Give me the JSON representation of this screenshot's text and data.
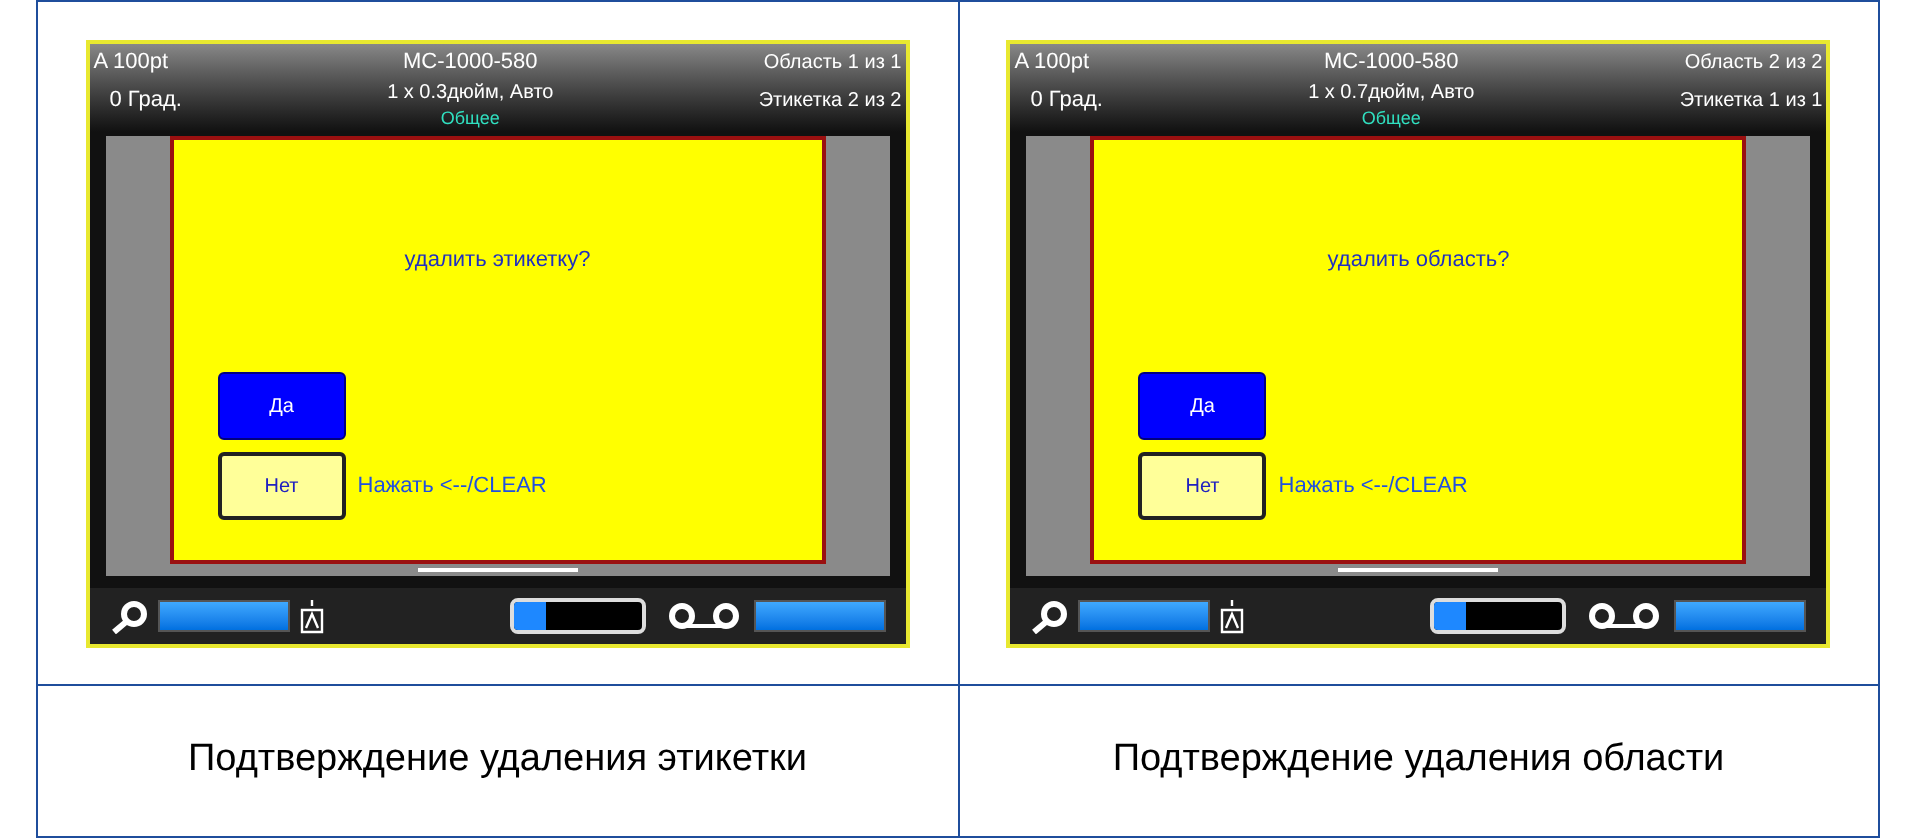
{
  "panels": [
    {
      "screen": {
        "font_size": "A 100pt",
        "rotation": "0 Град.",
        "part_number": "MC-1000-580",
        "label_size": "1 x 0.3дюйм, Авто",
        "mode": "Общее",
        "area_counter": "Область 1 из 1",
        "label_counter": "Этикетка 2 из 2",
        "dialog": {
          "question": "удалить этикетку?",
          "buttons": [
            {
              "label": "Да",
              "selected": true
            },
            {
              "label": "Нет",
              "selected": false
            }
          ],
          "hint": "Нажать <--/CLEAR"
        },
        "status_bar": {
          "zoom_bar": {
            "level": 1
          },
          "supply": {
            "level": 0.25
          },
          "ribbon_bar": {
            "level": 1
          }
        }
      },
      "caption": "Подтверждение удаления этикетки"
    },
    {
      "screen": {
        "font_size": "A 100pt",
        "rotation": "0 Град.",
        "part_number": "MC-1000-580",
        "label_size": "1 x 0.7дюйм, Авто",
        "mode": "Общее",
        "area_counter": "Область 2 из 2",
        "label_counter": "Этикетка 1 из 1",
        "dialog": {
          "question": "удалить область?",
          "buttons": [
            {
              "label": "Да",
              "selected": true
            },
            {
              "label": "Нет",
              "selected": false
            }
          ],
          "hint": "Нажать <--/CLEAR"
        },
        "status_bar": {
          "zoom_bar": {
            "level": 1
          },
          "supply": {
            "level": 0.25
          },
          "ribbon_bar": {
            "level": 1
          }
        }
      },
      "caption": "Подтверждение удаления области"
    }
  ]
}
